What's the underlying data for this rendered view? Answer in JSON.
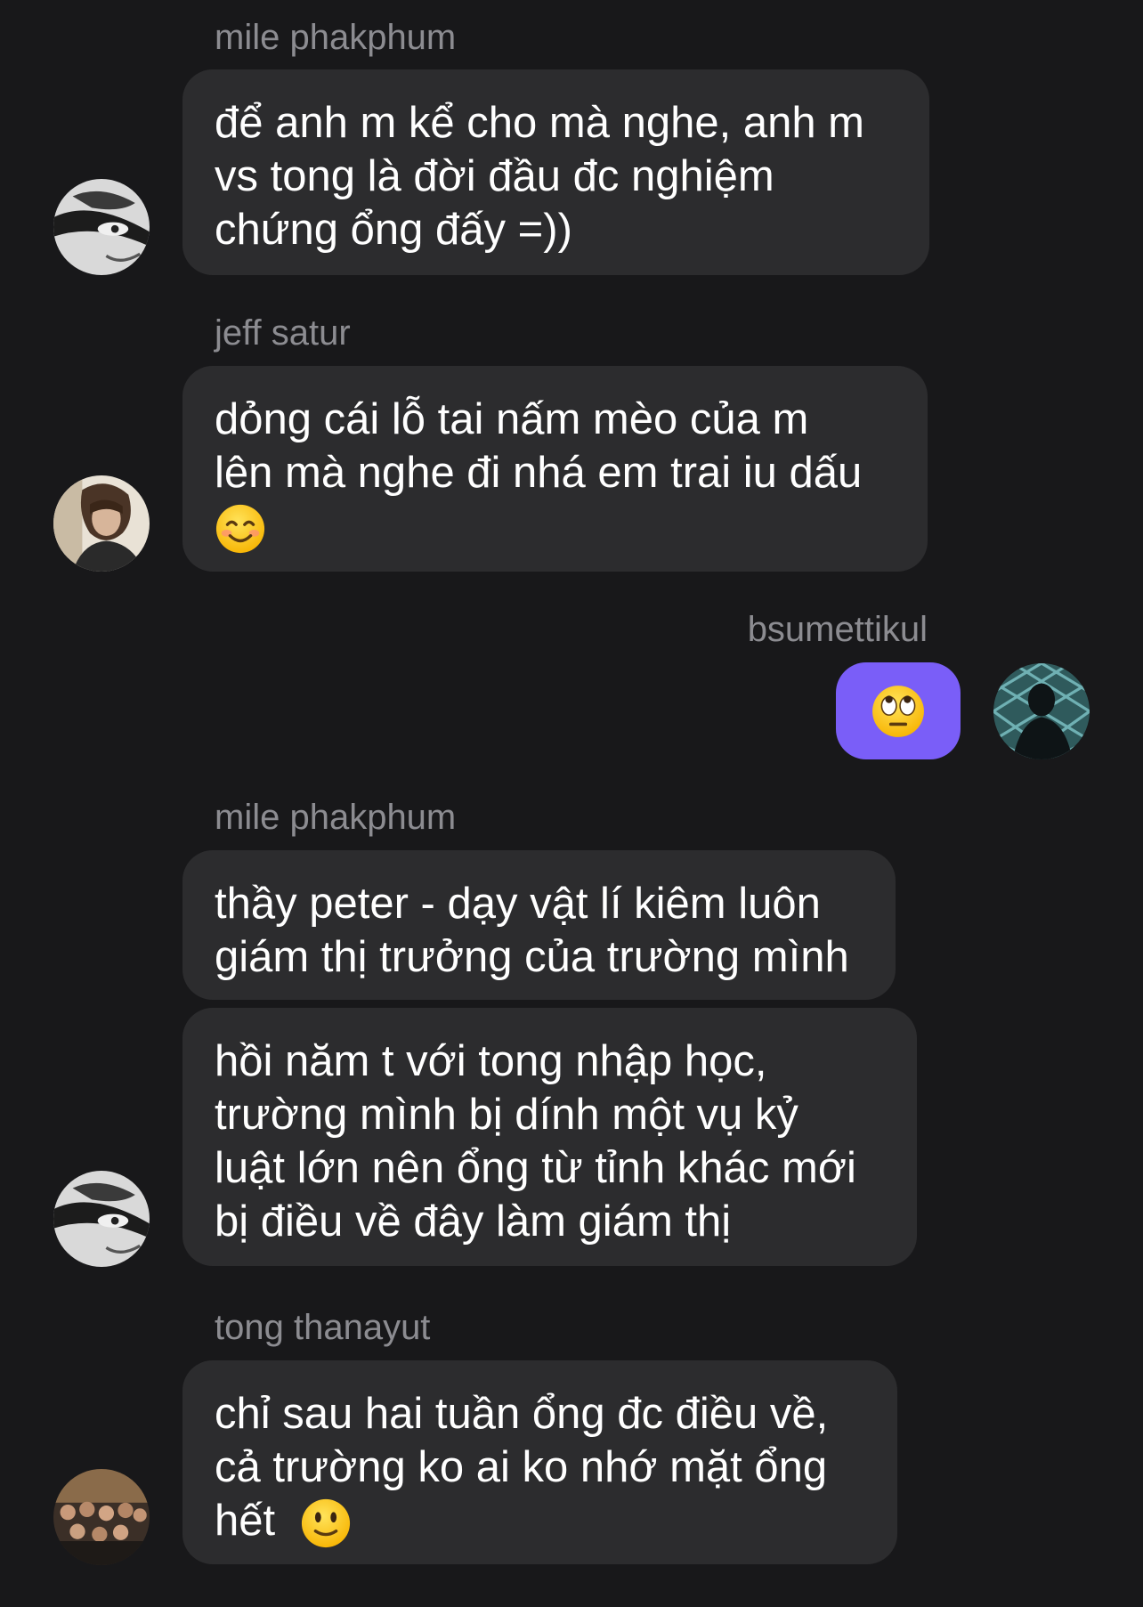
{
  "messages": [
    {
      "sender": "mile phakphum",
      "avatar": "avatar-mile-icon",
      "bubbles": [
        {
          "lines": [
            "để anh m kể cho mà nghe, anh m",
            "vs tong là đời đầu đc nghiệm",
            "chứng ổng đấy =))"
          ]
        }
      ]
    },
    {
      "sender": "jeff satur",
      "avatar": "avatar-jeff-icon",
      "bubbles": [
        {
          "lines": [
            "dỏng cái lỗ tai nấm mèo của m",
            "lên mà nghe đi nhá em trai iu dấu"
          ],
          "trailing_emoji": "smiling-face-icon"
        }
      ]
    },
    {
      "sender": "bsumettikul",
      "avatar": "avatar-bsumettikul-icon",
      "mine": true,
      "bubbles": [
        {
          "emoji": "eye-roll-face-icon"
        }
      ]
    },
    {
      "sender": "mile phakphum",
      "avatar": "avatar-mile-icon",
      "bubbles": [
        {
          "lines": [
            "thầy peter - dạy vật lí kiêm luôn",
            "giám thị trưởng của trường mình"
          ]
        },
        {
          "lines": [
            "hồi năm t với tong nhập học,",
            "trường mình bị dính một vụ kỷ",
            "luật lớn nên ổng từ tỉnh khác mới",
            "bị điều về đây làm giám thị"
          ]
        }
      ]
    },
    {
      "sender": "tong thanayut",
      "avatar": "avatar-tong-icon",
      "bubbles": [
        {
          "lines": [
            "chỉ sau hai tuần ổng đc điều về,",
            "cả trường ko ai ko nhớ mặt ổng",
            "hết"
          ],
          "trailing_emoji": "slightly-smiling-face-icon"
        }
      ]
    }
  ],
  "colors": {
    "background": "#18181a",
    "bubble_other": "#2c2c2e",
    "bubble_mine": "#7a5ef8",
    "sender_name": "#8c8c91",
    "text": "#ffffff"
  }
}
